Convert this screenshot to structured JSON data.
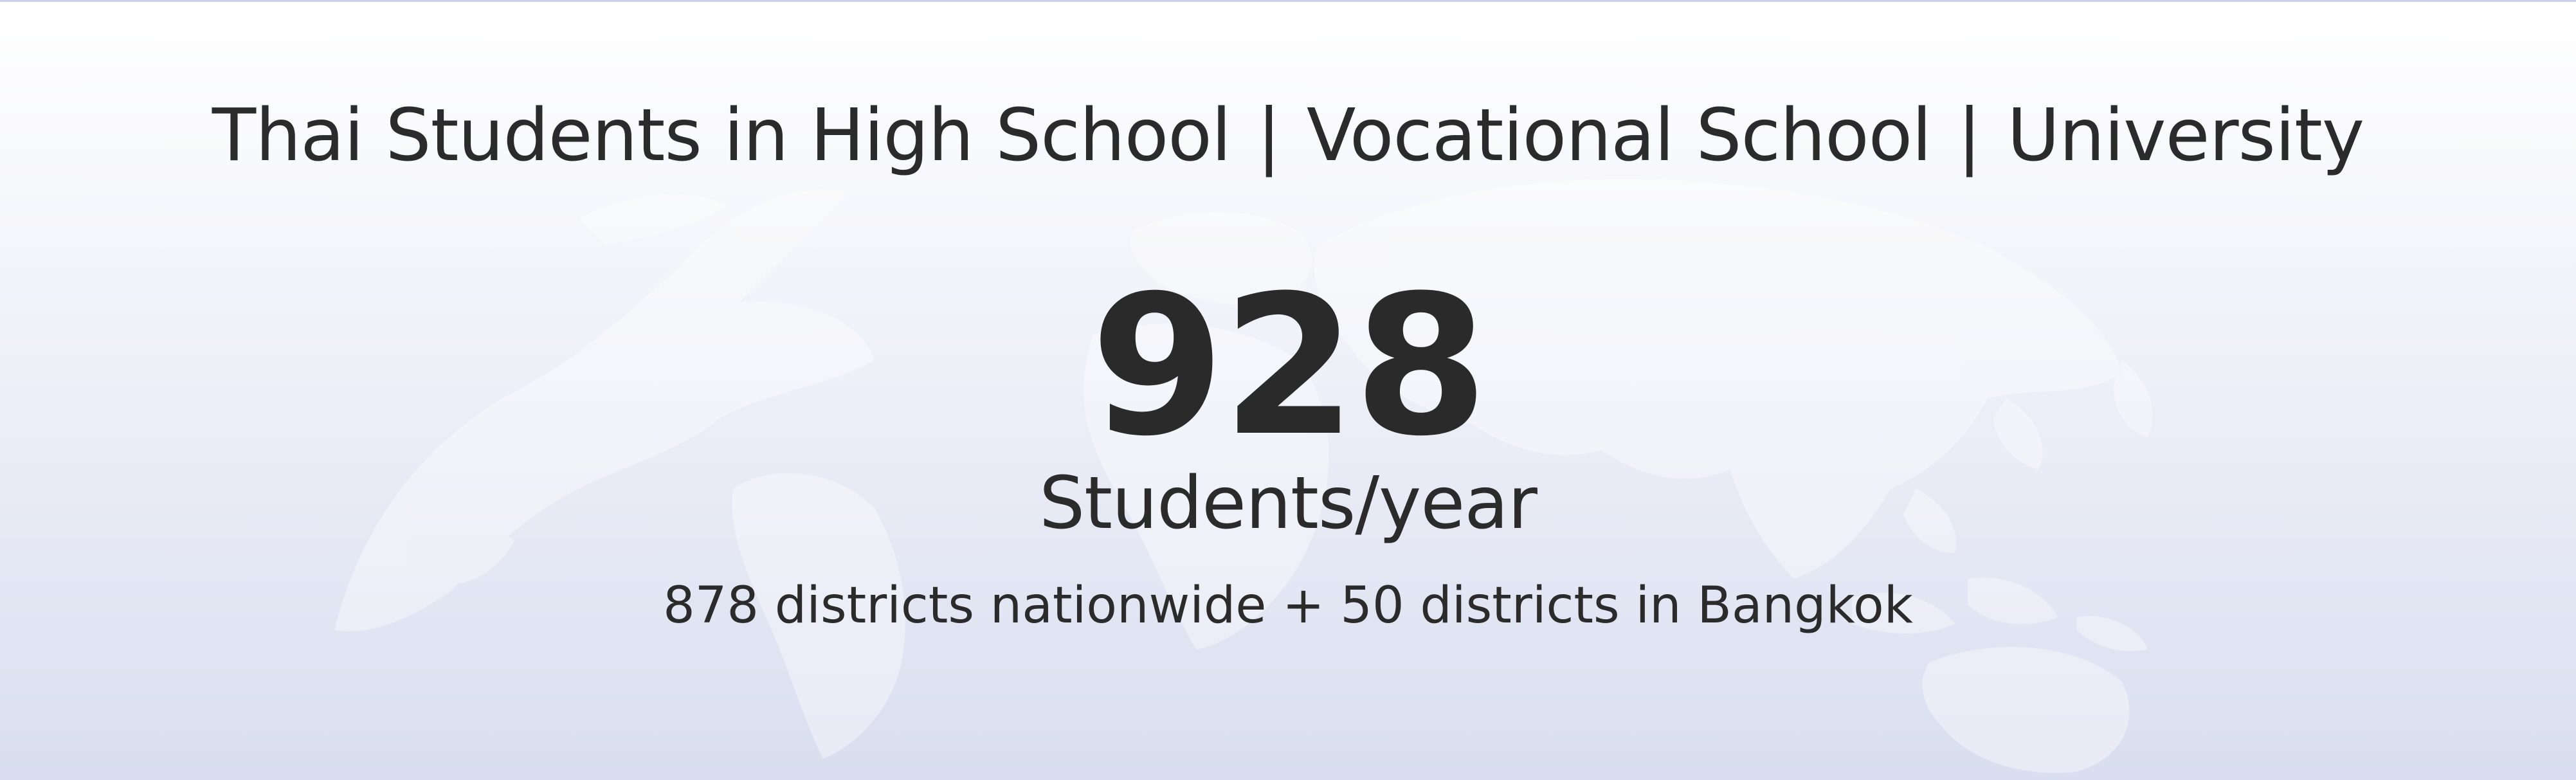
{
  "header": {
    "segments": [
      "Thai Students in High School",
      "Vocational School",
      "University"
    ],
    "separator": "|"
  },
  "stat": {
    "value": "928",
    "unit": "Students/year",
    "detail": "878 districts nationwide + 50 districts in Bangkok"
  },
  "background": {
    "map_icon": "world-map-icon"
  },
  "colors": {
    "text": "#2b2b2b",
    "map": "#ffffff"
  }
}
